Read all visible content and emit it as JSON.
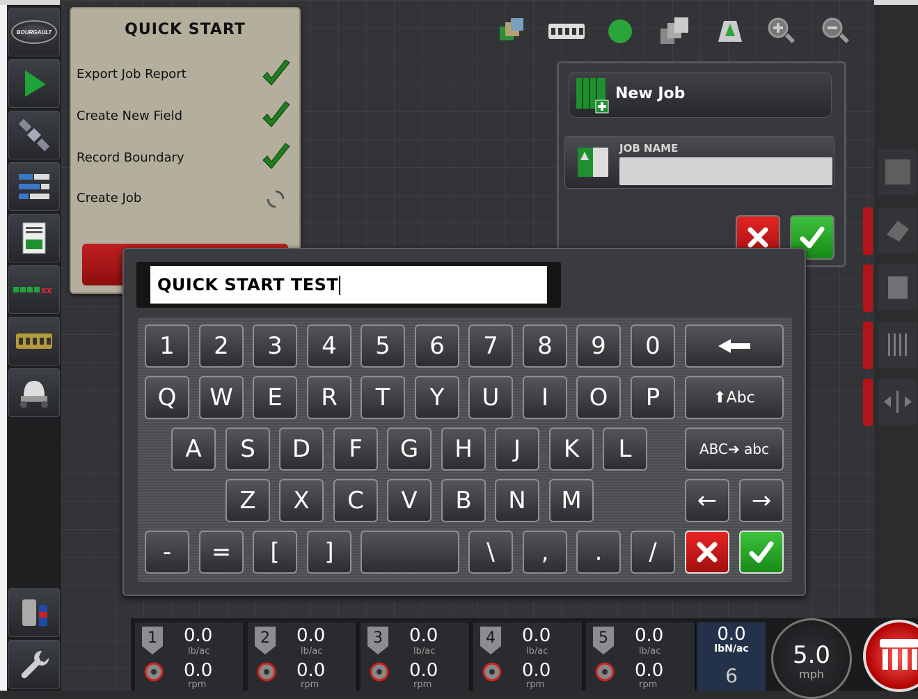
{
  "sidebar": {
    "logo_text": "BOURGAULT",
    "items": [
      {
        "icon": "logo-icon"
      },
      {
        "icon": "navigation-arrow-icon"
      },
      {
        "icon": "satellite-icon"
      },
      {
        "icon": "layers-list-icon"
      },
      {
        "icon": "job-report-icon"
      },
      {
        "icon": "section-control-icon",
        "label": "■■■xx"
      },
      {
        "icon": "implement-icon"
      },
      {
        "icon": "seeder-icon"
      },
      {
        "icon": "tank-meter-icon"
      },
      {
        "icon": "wrench-icon"
      }
    ]
  },
  "quick_start": {
    "title": "QUICK START",
    "steps": [
      {
        "label": "Export Job Report",
        "status": "done"
      },
      {
        "label": "Create New Field",
        "status": "done"
      },
      {
        "label": "Record Boundary",
        "status": "done"
      },
      {
        "label": "Create Job",
        "status": "in-progress"
      }
    ]
  },
  "job_panel": {
    "new_job_label": "New Job",
    "job_name_label": "JOB NAME",
    "job_name_value": ""
  },
  "keyboard": {
    "input_value": "QUICK START TEST",
    "rows": [
      [
        "1",
        "2",
        "3",
        "4",
        "5",
        "6",
        "7",
        "8",
        "9",
        "0"
      ],
      [
        "Q",
        "W",
        "E",
        "R",
        "T",
        "Y",
        "U",
        "I",
        "O",
        "P"
      ],
      [
        "A",
        "S",
        "D",
        "F",
        "G",
        "H",
        "J",
        "K",
        "L"
      ],
      [
        "Z",
        "X",
        "C",
        "V",
        "B",
        "N",
        "M"
      ],
      [
        "-",
        "=",
        "[",
        "]",
        " ",
        "\\",
        ",",
        ".",
        "/"
      ]
    ],
    "shift_label": "⬆Abc",
    "caps_label": "ABC➔ abc",
    "backspace": "🡐",
    "left_arrow": "←",
    "right_arrow": "→",
    "cancel": "✖",
    "ok": "✔"
  },
  "bottom": {
    "sections": [
      {
        "num": "1",
        "rate": "0.0",
        "rate_unit": "lb/ac",
        "rpm": "0.0",
        "rpm_unit": "rpm"
      },
      {
        "num": "2",
        "rate": "0.0",
        "rate_unit": "lb/ac",
        "rpm": "0.0",
        "rpm_unit": "rpm"
      },
      {
        "num": "3",
        "rate": "0.0",
        "rate_unit": "lb/ac",
        "rpm": "0.0",
        "rpm_unit": "rpm"
      },
      {
        "num": "4",
        "rate": "0.0",
        "rate_unit": "lb/ac",
        "rpm": "0.0",
        "rpm_unit": "rpm"
      },
      {
        "num": "5",
        "rate": "0.0",
        "rate_unit": "lb/ac",
        "rpm": "0.0",
        "rpm_unit": "rpm"
      }
    ],
    "total_rate": "0.0",
    "total_unit": "lbN/ac",
    "total_count": "6",
    "speed": "5.0",
    "speed_unit": "mph"
  },
  "colors": {
    "accent_green": "#2fae2f",
    "cancel_red": "#d61f1f",
    "panel_tan": "#b4ae9c"
  }
}
